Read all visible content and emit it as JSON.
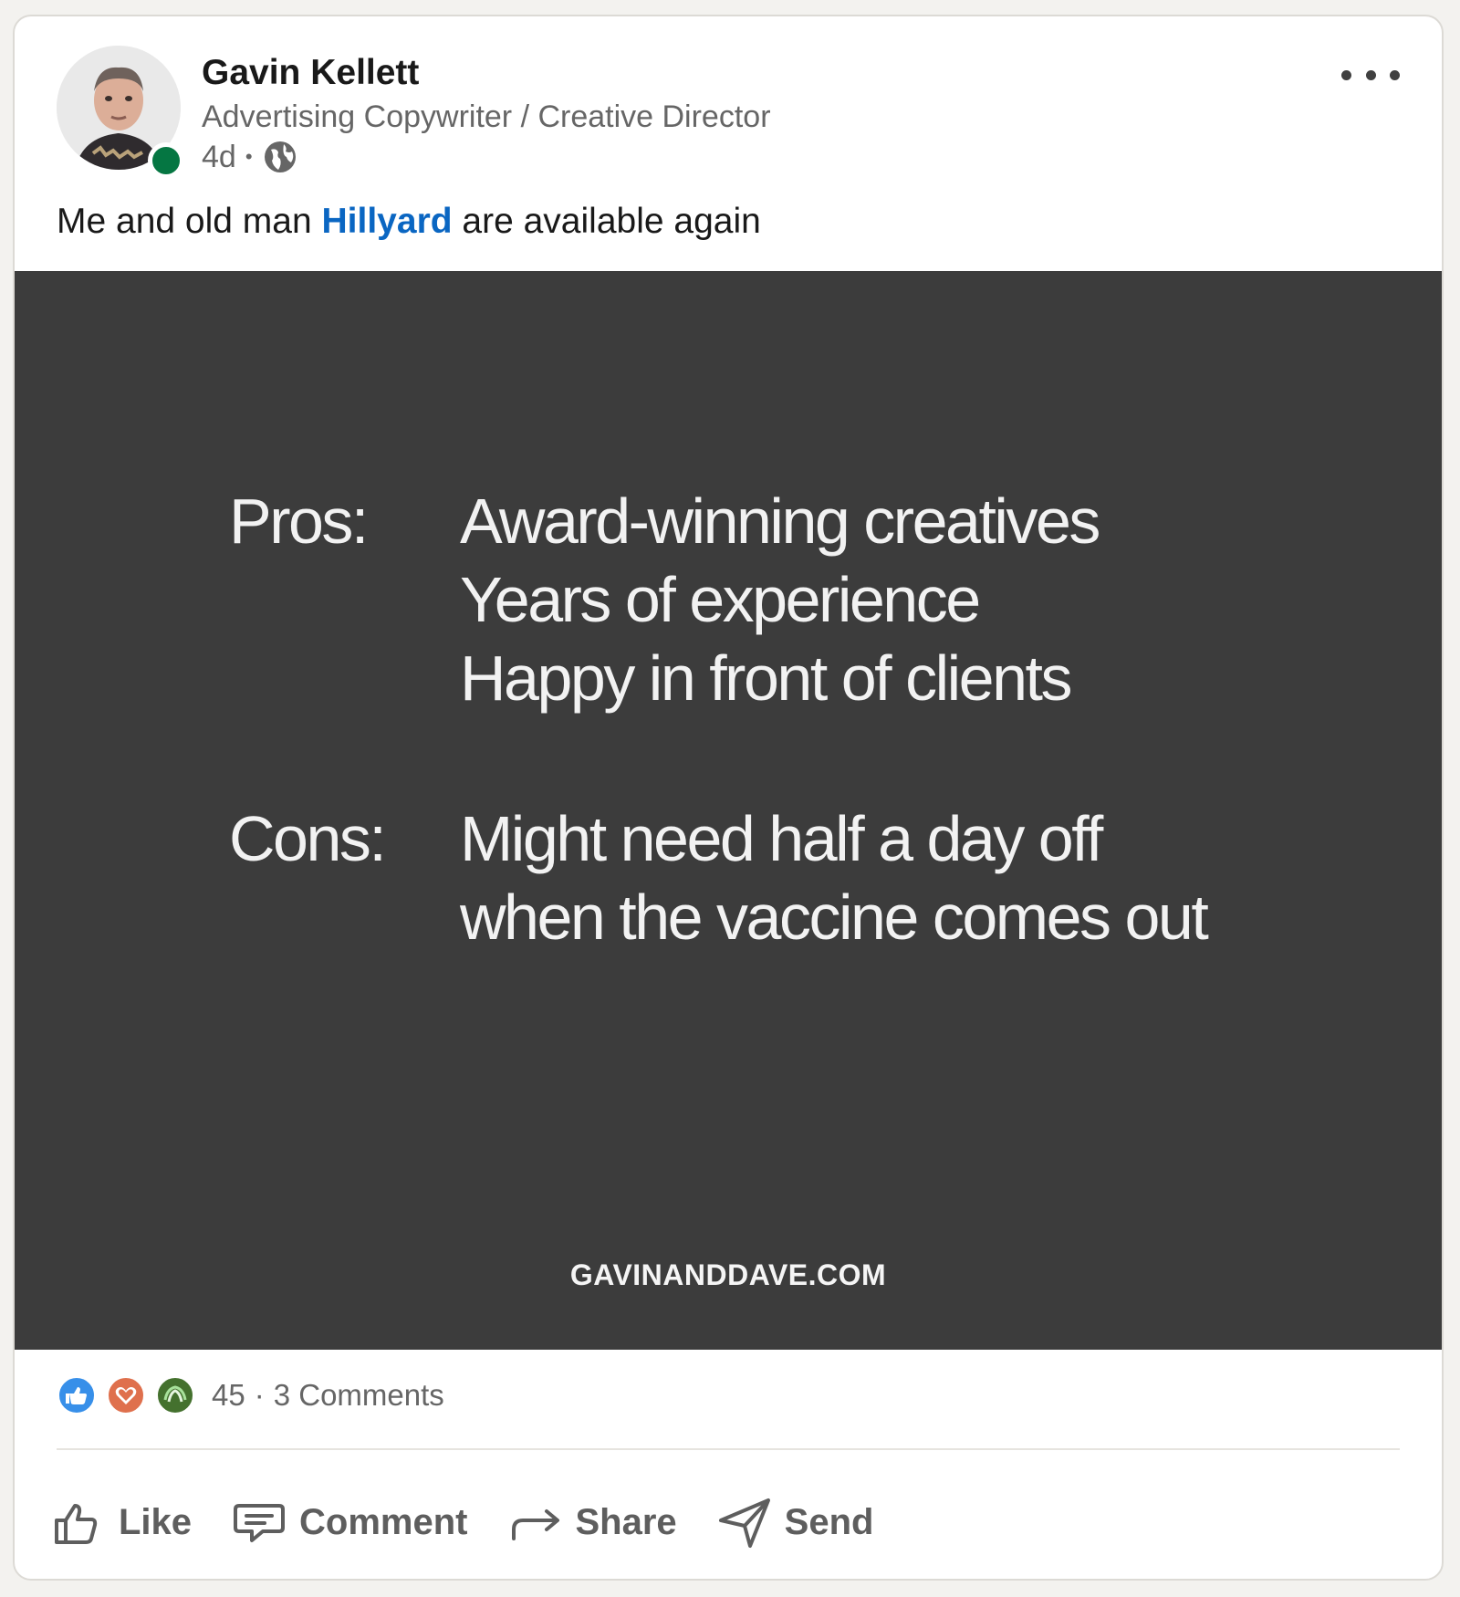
{
  "post": {
    "author": {
      "name": "Gavin Kellett",
      "headline": "Advertising Copywriter / Creative Director",
      "time": "4d",
      "separator": "•",
      "visibility_icon": "globe-icon"
    },
    "text_before": "Me and old man ",
    "mention": "Hillyard",
    "text_after": " are available again",
    "image": {
      "pros_label": "Pros:",
      "pros": [
        "Award-winning creatives",
        "Years of experience",
        "Happy in front of clients"
      ],
      "cons_label": "Cons:",
      "cons": [
        "Might need half a day off",
        "when the vaccine comes out"
      ],
      "site": "GAVINANDDAVE.COM"
    },
    "social": {
      "reactions": [
        "like-reaction-icon",
        "love-reaction-icon",
        "support-reaction-icon"
      ],
      "count": "45",
      "separator": "·",
      "comments": "3 Comments"
    },
    "actions": {
      "like": "Like",
      "comment": "Comment",
      "share": "Share",
      "send": "Send"
    }
  },
  "colors": {
    "accent": "#0a66c2",
    "online": "#057642",
    "image_bg": "#3c3c3c"
  }
}
